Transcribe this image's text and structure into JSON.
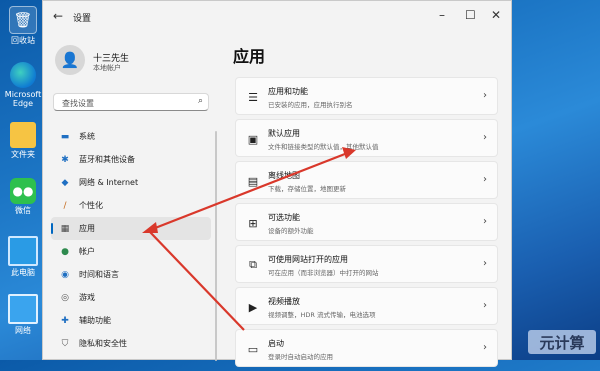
{
  "desktop": {
    "icons": [
      {
        "label": "回收站",
        "icon": "recycle-bin-icon"
      },
      {
        "label": "Microsoft Edge",
        "icon": "edge-icon"
      },
      {
        "label": "文件夹",
        "icon": "folder-icon"
      },
      {
        "label": "微信",
        "icon": "wechat-icon"
      },
      {
        "label": "此电脑",
        "icon": "computer-icon"
      },
      {
        "label": "网络",
        "icon": "network-icon"
      }
    ]
  },
  "window": {
    "title": "设置",
    "controls": {
      "minimize": "–",
      "maximize": "☐",
      "close": "✕"
    }
  },
  "profile": {
    "name": "十三先生",
    "account": "本地帐户"
  },
  "search": {
    "placeholder": "查找设置"
  },
  "nav": {
    "items": [
      {
        "label": "系统",
        "icon": "monitor-icon"
      },
      {
        "label": "蓝牙和其他设备",
        "icon": "bluetooth-icon"
      },
      {
        "label": "网络 & Internet",
        "icon": "wifi-icon"
      },
      {
        "label": "个性化",
        "icon": "brush-icon"
      },
      {
        "label": "应用",
        "icon": "apps-icon"
      },
      {
        "label": "帐户",
        "icon": "person-icon"
      },
      {
        "label": "时间和语言",
        "icon": "globe-clock-icon"
      },
      {
        "label": "游戏",
        "icon": "gamepad-icon"
      },
      {
        "label": "辅助功能",
        "icon": "accessibility-icon"
      },
      {
        "label": "隐私和安全性",
        "icon": "shield-icon"
      }
    ],
    "selected": "应用"
  },
  "main": {
    "title": "应用",
    "cards": [
      {
        "title": "应用和功能",
        "desc": "已安装的应用，应用执行别名",
        "icon": "list-icon"
      },
      {
        "title": "默认应用",
        "desc": "文件和链接类型的默认值，其他默认值",
        "icon": "default-app-icon"
      },
      {
        "title": "离线地图",
        "desc": "下载，存储位置，地图更新",
        "icon": "map-icon"
      },
      {
        "title": "可选功能",
        "desc": "设备的额外功能",
        "icon": "optional-features-icon"
      },
      {
        "title": "可使用网站打开的应用",
        "desc": "可在应用（而非浏览器）中打开的网站",
        "icon": "web-app-icon"
      },
      {
        "title": "视频播放",
        "desc": "视频调整，HDR 流式传输，电池选项",
        "icon": "video-icon"
      },
      {
        "title": "启动",
        "desc": "登录时自动启动的应用",
        "icon": "startup-icon"
      }
    ]
  },
  "watermark": {
    "text": "元计算"
  },
  "annotation": {
    "arrow_color": "#d9382b"
  }
}
